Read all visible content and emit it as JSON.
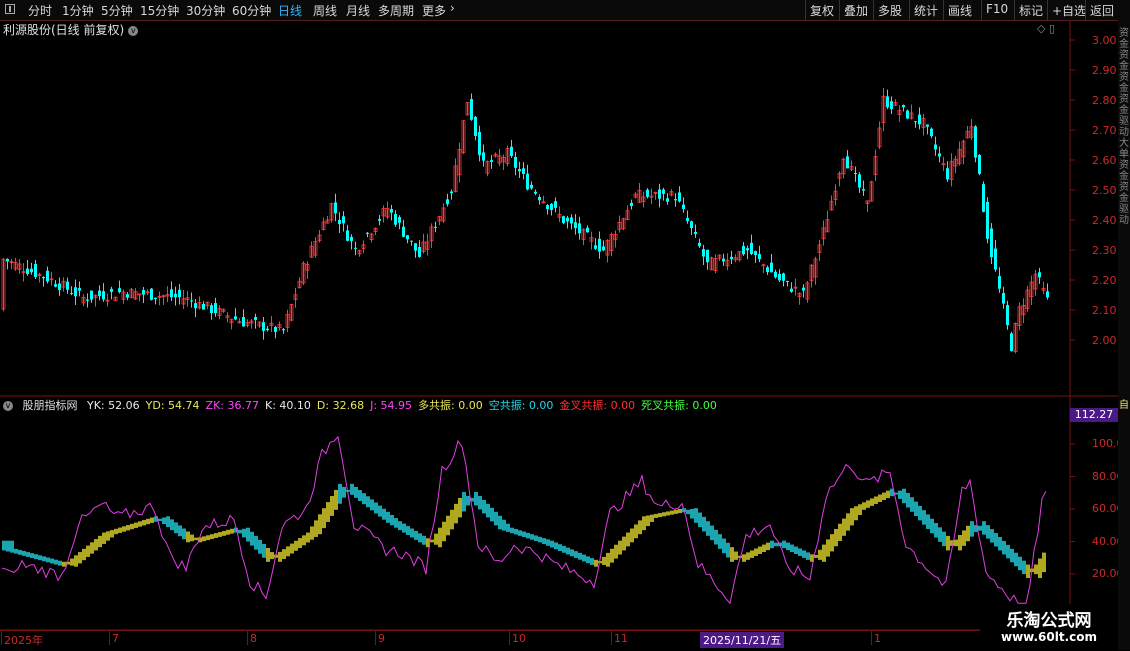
{
  "toolbar": {
    "periods": [
      "分时",
      "1分钟",
      "5分钟",
      "15分钟",
      "30分钟",
      "60分钟",
      "日线",
      "周线",
      "月线",
      "多周期",
      "更多"
    ],
    "active_period": "日线",
    "more_arrow": "›",
    "right_buttons": [
      "复权",
      "叠加",
      "多股",
      "统计",
      "画线",
      "F10",
      "标记",
      "+自选",
      "返回"
    ]
  },
  "chart": {
    "title": "利源股份(日线 前复权)",
    "price_axis": [
      "3.00",
      "2.90",
      "2.80",
      "2.70",
      "2.60",
      "2.50",
      "2.40",
      "2.30",
      "2.20",
      "2.10",
      "2.00"
    ],
    "ind_axis": [
      "100.0",
      "80.00",
      "60.00",
      "40.00",
      "20.00"
    ],
    "last_value": "112.27",
    "panel_icons": "◇ ▯"
  },
  "indicator": {
    "name": "股朋指标网",
    "items": [
      {
        "label": "YK: 52.06",
        "color": "#e8e8e8"
      },
      {
        "label": "YD: 54.74",
        "color": "#e8e85a"
      },
      {
        "label": "ZK: 36.77",
        "color": "#ff44ff"
      },
      {
        "label": "K: 40.10",
        "color": "#e8e8e8"
      },
      {
        "label": "D: 32.68",
        "color": "#e8e85a"
      },
      {
        "label": "J: 54.95",
        "color": "#ff44ff"
      },
      {
        "label": "多共振: 0.00",
        "color": "#e8e85a"
      },
      {
        "label": "空共振: 0.00",
        "color": "#22d8e8"
      },
      {
        "label": "金叉共振: 0.00",
        "color": "#ff3030"
      },
      {
        "label": "死叉共振: 0.00",
        "color": "#44ff44"
      }
    ]
  },
  "dates": {
    "labels": [
      "2025年",
      "7",
      "8",
      "9",
      "10",
      "11",
      "1"
    ],
    "highlight": "2025/11/21/五"
  },
  "right_edge_text": "资金资金资金资金驱动大单资金资金驱动",
  "right_edge_bottom": "自",
  "watermark": {
    "title": "乐淘公式网",
    "url": "www.60lt.com"
  },
  "colors": {
    "up": "#ff3b3b",
    "down": "#00ffff",
    "band_up": "#b0a820",
    "band_down": "#1aa5b0",
    "j_line": "#e040e0",
    "grid": "#7a1010"
  }
}
